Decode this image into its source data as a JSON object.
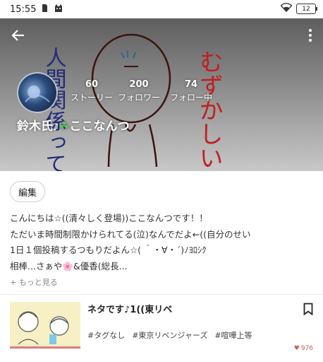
{
  "status_bar": {
    "time": "15:55",
    "battery": "12"
  },
  "profile": {
    "stats": [
      {
        "count": "60",
        "label": "ストーリー"
      },
      {
        "count": "200",
        "label": "フォロワー"
      },
      {
        "count": "74",
        "label": "フォロー中"
      }
    ],
    "name_prefix": "鈴木氏",
    "name_suffix": "ここなんつ",
    "header_art_text_left": "人間関係って",
    "header_art_text_right": "むずかしい"
  },
  "edit_button": "編集",
  "bio": {
    "lines": [
      "こんにちは☆((清々しく登場))ここなんつです！！",
      "ただいま時間制限かけられてる(泣)なんでだよ←((自分のせい",
      "1日１個投稿するつもりだよん☆( ｀・∀・´)ﾉﾖﾛｼｸ",
      "相棒...さぁや🌸&優香(総長..."
    ],
    "more_label": "+ もっと見る"
  },
  "story": {
    "title": "ネタです♪1((東リベ",
    "tags": [
      "#タグなし",
      "#東京リベンジャーズ",
      "#喧嘩上等"
    ],
    "likes": "976"
  }
}
